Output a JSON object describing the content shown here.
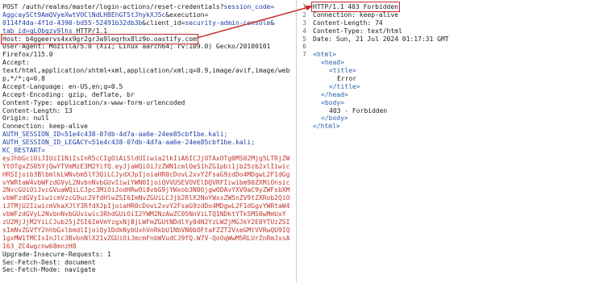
{
  "request": {
    "line1": "POST /auth/realms/master/login-actions/reset-credentials?",
    "line1_param": "session_code=",
    "session_code_l2": "AggcaySCt9AmQVyeXwtVOClNdLH8EhGTStJhykXJ5c",
    "execution_key": "&execution=",
    "execution_l3": "0114f4da-4f1d-4390-bd55-52491b32db3b",
    "client_key": "&client_id=",
    "client_val": "security-admin-console",
    "amp_line_end": "&",
    "tab_key": "tab_id=",
    "tab_val": "gLObgzv9lhs",
    "http": " HTTP/1.1",
    "host": "Host: b4ggeervs4xx9gr2gr3a9leqrhx8lz9o.oastify.com",
    "user_agent": "User-Agent: Mozilla/5.0 (X11; Linux aarch64; rv:109.0) Gecko/20100101",
    "firefox": "Firefox/115.0",
    "accept": "Accept:",
    "accept_val": "text/html,application/xhtml+xml,application/xml;q=0.9,image/avif,image/web",
    "accept_val2": "p,*/*;q=0.8",
    "accept_lang": "Accept-Language: en-US,en;q=0.5",
    "accept_enc": "Accept-Encoding: gzip, deflate, br",
    "content_type": "Content-Type: application/x-www-form-urlencoded",
    "content_length": "Content-Length: 13",
    "origin": "Origin: null",
    "connection": "Connection: keep-alive",
    "cookie_auth": "AUTH_SESSION_ID=51e4c438-07db-4d7a-aa6e-24ee85cbf1be.kali;",
    "cookie_legacy": "AUTH_SESSION_ID_LEGACY=51e4c438-07db-4d7a-aa6e-24ee85cbf1be.kali;",
    "kc_restart": "KC_RESTART=",
    "token_lines": [
      "eyJhbGciOiJIUzI1NiIsInR5cCIgOiAiSldUIiwia2lkIiA6ICJjOTAxOTg0MS02Mjg5LTRjZW",
      "YtOTgxZS05YjQwYTVmMzE3M2YifQ.eyJjaWQiOiJzZWN1cmlOeS1hZG1pbi1jb25zb2xlIiwic",
      "HRSIjoib3BlbmlkLWNvbm5lY3QiLCJydXJpIjoiaHR0cDovL2xvY2FsaG9zdDo4MDgwL2F1dGg",
      "vYWRtaW4vbWFzdGVyL2NvbnNvbGUvIiwiYWN0IjoiQVVUSEVOVElDQVRFIiwibm90ZXMiOnsic",
      "2NvcGUiOiJvcGVuaWQiLCJpc3MiOiJodHRwOi8vbG9jYWxob3N0OjgwODAvYXV0aC9yZWFsbXM",
      "vbWFzdGVyIiwicmVzcG9uc2VfdHlwZSI6ImNvZGUiLCJjb2RlX2NoYWxsZW5nZV9tZXRob2QiO",
      "iJTMjU2IiwicmVkaXJlY3RfdXJpIjoiaHR0cDovL2xvY2FsaG9zdDo4MDgwL2F1dGgvYWRtaW4",
      "vbWFzdGVyL2NvbnNvbGUviwic3RhdGUiOiI2YWM2NzAwZC05NnViLTQ1NDktYTk5MS0wMmUxY",
      "zU2MjJjM2YiLCJub25jZSI6ImVmYzgxNjBjLWFmZGUtNDdlYy04N2YzLWZjMGJkY2E0YTUzZSI",
      "sImNvZGVfY2hhbGxlbmdlIjoiQy1DdkNybUxhVnRkbU1NbVN0bOFtaFZZT2VseGMtVVRwQU9IQ",
      "1gxMW1TMCIsInJlc3BvbnNlX21vZGUiOiJmcmFnbWVudCJ9fQ.W7V-QoOqWwM5RLUrZnRmJxsA",
      "163_ZC4wgcnw68mnzH8"
    ],
    "upgrade": "Upgrade-Insecure-Requests: 1",
    "sec_dest": "Sec-Fetch-Dest: document",
    "sec_mode": "Sec-Fetch-Mode: navigate"
  },
  "response": {
    "line_numbers": [
      "1",
      "2",
      "3",
      "4",
      "5",
      "6",
      "7"
    ],
    "status": "HTTP/1.1 403 Forbidden",
    "connection": "Connection: keep-alive",
    "content_length": "Content-Length: 74",
    "content_type": "Content-Type: text/html",
    "date": "Date: Sun, 21 Jul 2024 01:17:31 GMT",
    "html_open": "<html>",
    "head_open": "<head>",
    "title_open": "<title>",
    "title_text": "Error",
    "title_close": "</title>",
    "head_close": "</head>",
    "body_open": "<body>",
    "body_text": "403 - Forbidden",
    "body_close": "</body>",
    "html_close": "</html>"
  },
  "colors": {
    "highlight_box": "#c62828",
    "header_key": "#1f3fa8",
    "cookie": "#c0392b",
    "tag": "#2b5fa8"
  }
}
